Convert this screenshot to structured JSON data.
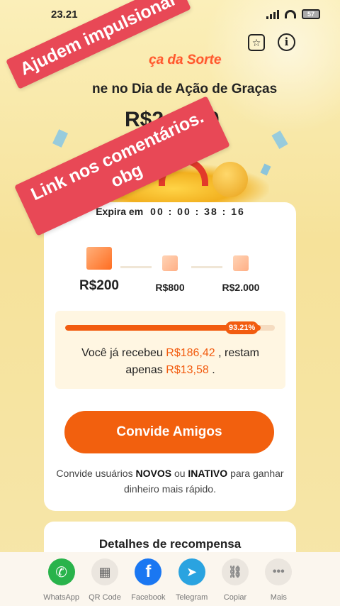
{
  "status_bar": {
    "time": "23.21",
    "battery": "57"
  },
  "header": {
    "logo_text": "ça da Sorte"
  },
  "promo": {
    "title": "ne no Dia de Ação de Graças",
    "amount": "R$2",
    "amount_tail": "0"
  },
  "overlay": {
    "banner_1": "Ajudem impulsionar",
    "banner_2_line1": "Link nos comentários.",
    "banner_2_line2": "obg"
  },
  "expiry": {
    "label": "Expira em",
    "timer": "00 : 00 : 38 : 16"
  },
  "tiers": [
    {
      "label": "R$200"
    },
    {
      "label": "R$800"
    },
    {
      "label": "R$2.000"
    }
  ],
  "progress": {
    "percent_value": 93.21,
    "percent_label": "93.21%",
    "text_prefix": "Você já recebeu",
    "received": "R$186,42",
    "text_mid": ", restam",
    "text_apenas": "apenas",
    "remaining": "R$13,58",
    "text_end": "."
  },
  "invite": {
    "button_label": "Convide Amigos",
    "note_prefix": "Convide usuários",
    "note_new": "NOVOS",
    "note_or": "ou",
    "note_inactive": "INATIVO",
    "note_suffix": "para ganhar",
    "note_line2": "dinheiro mais rápido."
  },
  "details": {
    "title": "Detalhes de recompensa"
  },
  "share": [
    {
      "label": "WhatsApp",
      "icon": "whatsapp-icon",
      "color": "#29b34b"
    },
    {
      "label": "QR Code",
      "icon": "qr-code-icon",
      "color": "#ebe6df"
    },
    {
      "label": "Facebook",
      "icon": "facebook-icon",
      "color": "#1a77f2"
    },
    {
      "label": "Telegram",
      "icon": "telegram-icon",
      "color": "#2aa3e0"
    },
    {
      "label": "Copiar",
      "icon": "copy-link-icon",
      "color": "#ebe6df"
    },
    {
      "label": "Mais",
      "icon": "more-icon",
      "color": "#ebe6df"
    }
  ],
  "colors": {
    "accent": "#f2600e",
    "banner": "#e84856"
  }
}
